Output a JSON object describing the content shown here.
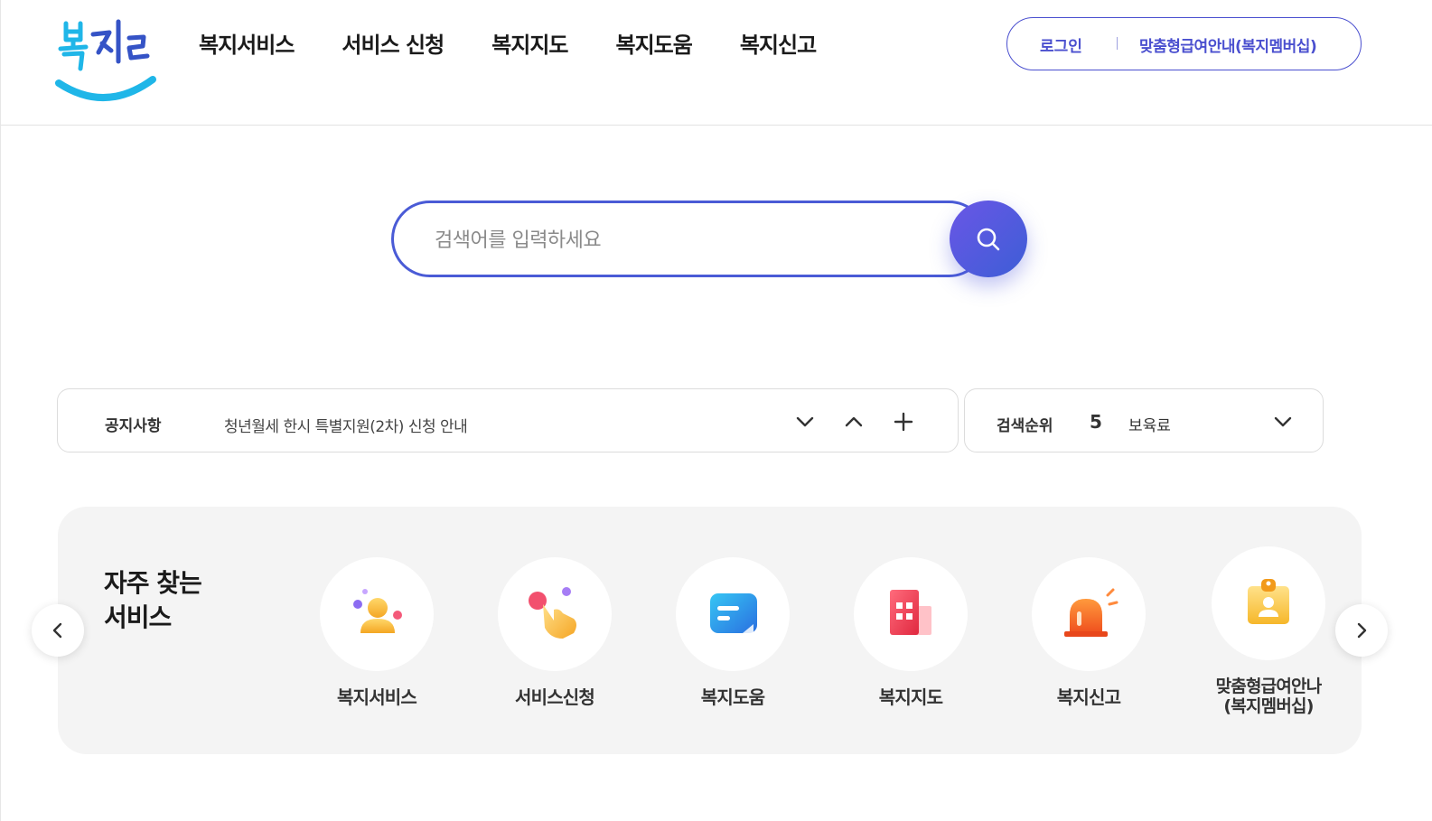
{
  "header": {
    "logo_text": "복지로",
    "nav": [
      {
        "label": "복지서비스"
      },
      {
        "label": "서비스 신청"
      },
      {
        "label": "복지지도"
      },
      {
        "label": "복지도움"
      },
      {
        "label": "복지신고"
      }
    ],
    "login_label": "로그인",
    "membership_label": "맞춤형급여안내(복지멤버십)"
  },
  "search": {
    "placeholder": "검색어를 입력하세요",
    "button_icon": "search-icon"
  },
  "notice": {
    "label": "공지사항",
    "text": "청년월세 한시 특별지원(2차) 신청 안내",
    "controls": [
      "chevron-down-icon",
      "chevron-up-icon",
      "plus-icon"
    ]
  },
  "ranking": {
    "label": "검색순위",
    "rank": "5",
    "keyword": "보육료"
  },
  "frequent": {
    "title_line1": "자주 찾는",
    "title_line2": "서비스",
    "items": [
      {
        "label": "복지서비스",
        "icon": "people-icon"
      },
      {
        "label": "서비스신청",
        "icon": "hand-pointer-icon"
      },
      {
        "label": "복지도움",
        "icon": "chat-bubble-icon"
      },
      {
        "label": "복지지도",
        "icon": "building-icon"
      },
      {
        "label": "복지신고",
        "icon": "siren-icon"
      },
      {
        "label_line1": "맞춤형급여안나",
        "label_line2": "(복지멤버십)",
        "icon": "id-badge-icon"
      }
    ]
  },
  "colors": {
    "brand": "#4a4fcf",
    "logo_blue": "#1fb6e8",
    "search_border": "#4a5bd6",
    "panel_bg": "#f4f4f4"
  }
}
